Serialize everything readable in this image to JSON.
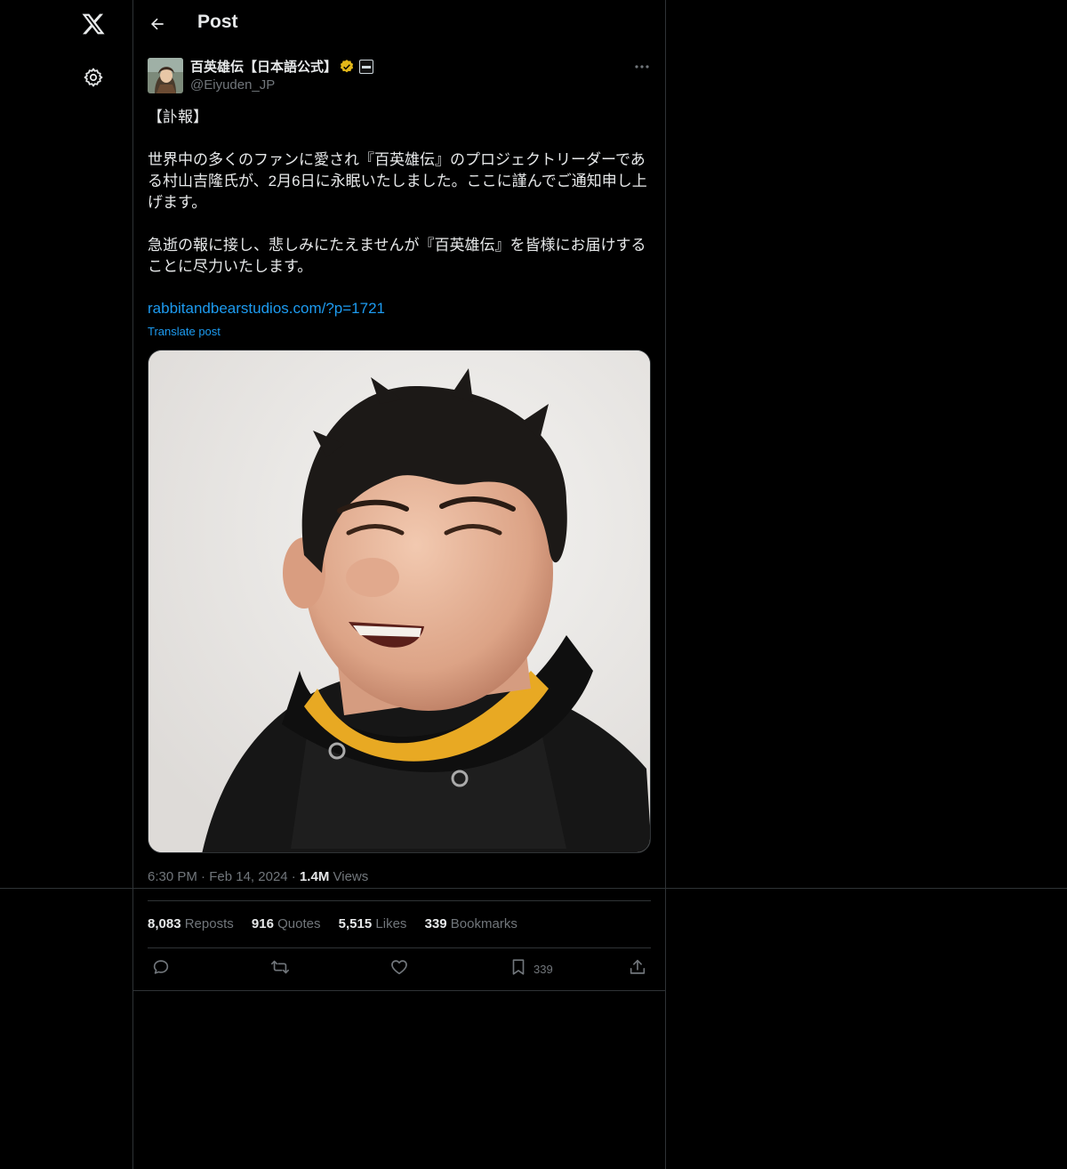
{
  "header": {
    "title": "Post",
    "back_icon": "arrow-left-icon"
  },
  "sidebar": {
    "logo_icon": "x-logo-icon",
    "settings_icon": "gear-icon"
  },
  "post": {
    "display_name": "百英雄伝【日本語公式】",
    "handle": "@Eiyuden_JP",
    "verified_color": "#e2b719",
    "paragraphs": [
      "【訃報】",
      "世界中の多くのファンに愛され『百英雄伝』のプロジェクトリーダーである村山吉隆氏が、2月6日に永眠いたしました。ここに謹んでご通知申し上げます。",
      "急逝の報に接し、悲しみにたえませんが『百英雄伝』を皆様にお届けすることに尽力いたします。"
    ],
    "link": "rabbitandbearstudios.com/?p=1721",
    "translate_label": "Translate post",
    "time": "6:30 PM",
    "date": "Feb 14, 2024",
    "views_count": "1.4M",
    "views_label": "Views"
  },
  "stats": {
    "reposts_count": "8,083",
    "reposts_label": "Reposts",
    "quotes_count": "916",
    "quotes_label": "Quotes",
    "likes_count": "5,515",
    "likes_label": "Likes",
    "bookmarks_count": "339",
    "bookmarks_label": "Bookmarks"
  },
  "actions": {
    "reply_icon": "reply-icon",
    "repost_icon": "repost-icon",
    "like_icon": "heart-icon",
    "bookmark_icon": "bookmark-icon",
    "bookmark_count": "339",
    "share_icon": "share-icon"
  },
  "colors": {
    "background": "#000000",
    "text": "#e7e9ea",
    "secondary": "#71767b",
    "link": "#1d9bf0",
    "border": "#2f3336"
  }
}
